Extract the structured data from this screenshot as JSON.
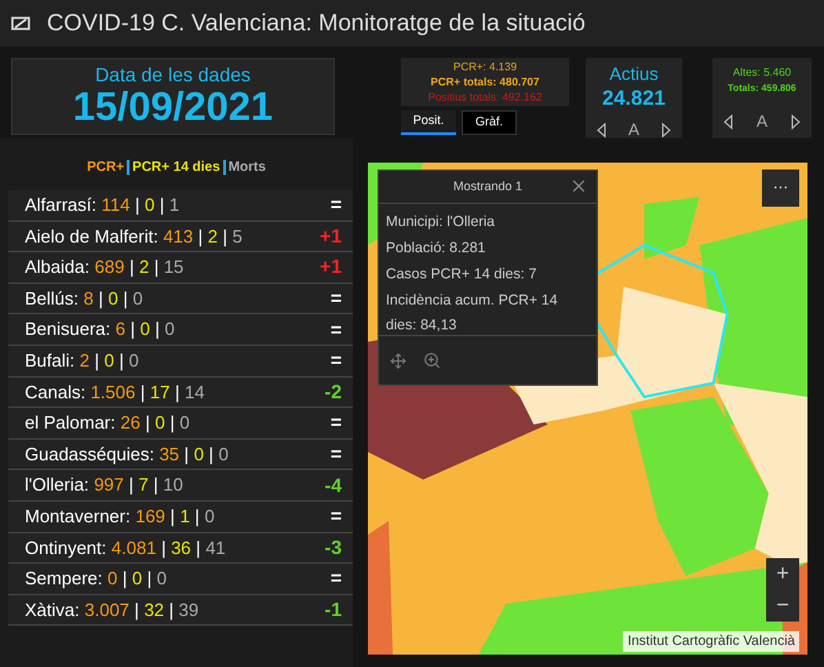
{
  "window": {
    "title": "COVID-19 C. Valenciana: Monitoratge de la situació"
  },
  "date_card": {
    "label": "Data de les dades",
    "value": "15/09/2021"
  },
  "pcr_card": {
    "pcr": "PCR+: 4.139",
    "pcr_total": "PCR+ totals: 480.707",
    "positive_total": "Positius totals: 492.162"
  },
  "pcr_tabs": [
    {
      "label": "Posit.",
      "selected": true
    },
    {
      "label": "Gràf.",
      "selected": false
    }
  ],
  "active_card": {
    "label": "Actius",
    "value": "24.821",
    "pager": "A"
  },
  "discharge_card": {
    "line_1": "Altes: 5.460",
    "line_2": "Totals: 459.806",
    "pager": "A"
  },
  "legend": [
    "PCR+",
    "PCR+ 14 dies",
    "Morts"
  ],
  "municipalities": [
    {
      "name": "Alfarrasí:",
      "pcr": "114",
      "pcr14": "0",
      "deaths": "1",
      "separators": [
        "|",
        "|"
      ],
      "change": "=",
      "kind": "same"
    },
    {
      "name": "Aielo de Malferit:",
      "pcr": "413",
      "pcr14": "2",
      "deaths": "5",
      "separators": [
        "|",
        "|"
      ],
      "change": "+1",
      "kind": "up"
    },
    {
      "name": "Albaida:",
      "pcr": "689",
      "pcr14": "2",
      "deaths": "15",
      "separators": [
        "|",
        "|"
      ],
      "change": "+1",
      "kind": "up"
    },
    {
      "name": "Bellús:",
      "pcr": "8",
      "pcr14": "0",
      "deaths": "0",
      "separators": [
        "|",
        "|"
      ],
      "change": "=",
      "kind": "same"
    },
    {
      "name": "Benisuera:",
      "pcr": "6",
      "pcr14": "0",
      "deaths": "0",
      "separators": [
        "|",
        "|"
      ],
      "change": "=",
      "kind": "same"
    },
    {
      "name": "Bufali:",
      "pcr": "2",
      "pcr14": "0",
      "deaths": "0",
      "separators": [
        "|",
        "|"
      ],
      "change": "=",
      "kind": "same"
    },
    {
      "name": "Canals:",
      "pcr": "1.506",
      "pcr14": "17",
      "deaths": "14",
      "separators": [
        "|",
        "|"
      ],
      "change": "-2",
      "kind": "down"
    },
    {
      "name": "el Palomar:",
      "pcr": "26",
      "pcr14": "0",
      "deaths": "0",
      "separators": [
        "|",
        "|"
      ],
      "change": "=",
      "kind": "same"
    },
    {
      "name": "Guadasséquies:",
      "pcr": "35",
      "pcr14": "0",
      "deaths": "0",
      "separators": [
        "|",
        "|"
      ],
      "change": "=",
      "kind": "same"
    },
    {
      "name": "l'Olleria:",
      "pcr": "997",
      "pcr14": "7",
      "deaths": "10",
      "separators": [
        "|",
        "|"
      ],
      "change": "-4",
      "kind": "down"
    },
    {
      "name": "Montaverner:",
      "pcr": "169",
      "pcr14": "1",
      "deaths": "0",
      "separators": [
        "|",
        "|"
      ],
      "change": "=",
      "kind": "same"
    },
    {
      "name": "Ontinyent:",
      "pcr": "4.081",
      "pcr14": "36",
      "deaths": "41",
      "separators": [
        "|",
        "|"
      ],
      "change": "-3",
      "kind": "down"
    },
    {
      "name": "Sempere:",
      "pcr": "0",
      "pcr14": "0",
      "deaths": "0",
      "separators": [
        "|",
        "|"
      ],
      "change": "=",
      "kind": "same"
    },
    {
      "name": "Xàtiva:",
      "pcr": "3.007",
      "pcr14": "32",
      "deaths": "39",
      "separators": [
        "|",
        "|"
      ],
      "change": "-1",
      "kind": "down"
    }
  ],
  "map": {
    "attribution": "Institut Cartogràfic Valencià",
    "zoom_in": "+",
    "zoom_out": "−",
    "more": "···",
    "popup": {
      "title": "Mostrando 1",
      "lines": [
        "Municipi: l'Olleria",
        "Població: 8.281",
        "Casos PCR+ 14 dies: 7",
        "Incidència acum. PCR+ 14 dies: 84,13"
      ]
    }
  }
}
